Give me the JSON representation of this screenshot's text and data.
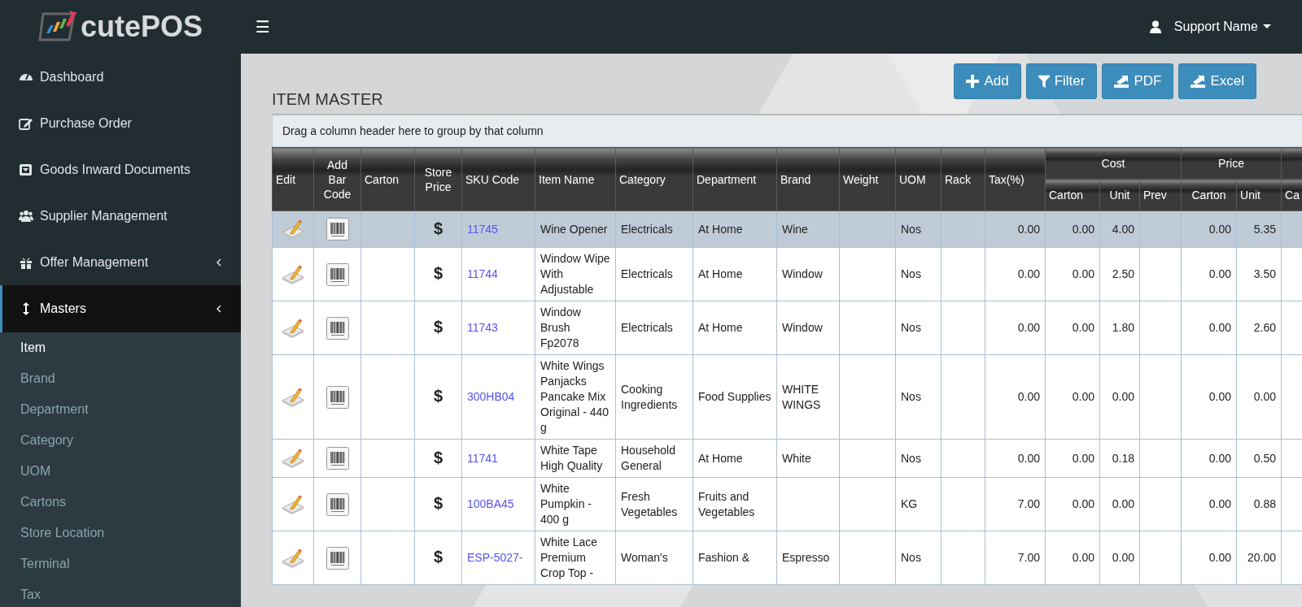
{
  "brand": {
    "name": "cutePOS"
  },
  "topbar": {
    "menu_glyph": "☰",
    "user": "Support Name"
  },
  "sidebar": {
    "items": [
      {
        "label": "Dashboard",
        "has_submenu": false,
        "selected": false
      },
      {
        "label": "Purchase Order",
        "has_submenu": false,
        "selected": false
      },
      {
        "label": "Goods Inward Documents",
        "has_submenu": false,
        "selected": false
      },
      {
        "label": "Supplier Management",
        "has_submenu": false,
        "selected": false
      },
      {
        "label": "Offer Management",
        "has_submenu": true,
        "selected": false
      },
      {
        "label": "Masters",
        "has_submenu": true,
        "selected": true,
        "children": [
          {
            "label": "Item",
            "selected": true
          },
          {
            "label": "Brand",
            "selected": false
          },
          {
            "label": "Department",
            "selected": false
          },
          {
            "label": "Category",
            "selected": false
          },
          {
            "label": "UOM",
            "selected": false
          },
          {
            "label": "Cartons",
            "selected": false
          },
          {
            "label": "Store Location",
            "selected": false
          },
          {
            "label": "Terminal",
            "selected": false
          },
          {
            "label": "Tax",
            "selected": false
          }
        ]
      }
    ]
  },
  "page": {
    "title": "ITEM MASTER",
    "buttons": [
      "Add",
      "Filter",
      "PDF",
      "Excel"
    ]
  },
  "table": {
    "group_hint": "Drag a column header here to group by that column",
    "columns": [
      {
        "label": "Edit"
      },
      {
        "label": "Add Bar Code"
      },
      {
        "label": "Carton"
      },
      {
        "label": "Store Price"
      },
      {
        "label": "SKU Code"
      },
      {
        "label": "Item Name"
      },
      {
        "label": "Category"
      },
      {
        "label": "Department"
      },
      {
        "label": "Brand"
      },
      {
        "label": "Weight"
      },
      {
        "label": "UOM"
      },
      {
        "label": "Rack"
      },
      {
        "label": "Tax(%)"
      },
      {
        "label": "Cost",
        "children": [
          {
            "label": "Carton"
          },
          {
            "label": "Unit"
          },
          {
            "label": "Prev"
          }
        ]
      },
      {
        "label": "Price",
        "children": [
          {
            "label": "Carton"
          },
          {
            "label": "Unit"
          }
        ]
      },
      {
        "children": [
          {
            "label": "Ca"
          }
        ]
      }
    ],
    "rows": [
      {
        "selected": true,
        "store_price": "$",
        "sku": "11745",
        "item_name": "Wine Opener",
        "category": "Electricals",
        "department": "At Home",
        "brand": "Wine",
        "uom": "Nos",
        "tax": "0.00",
        "cost_carton": "0.00",
        "cost_unit": "4.00",
        "price_carton": "0.00",
        "price_unit": "5.35"
      },
      {
        "selected": false,
        "store_price": "$",
        "sku": "11744",
        "item_name": "Window Wipe With Adjustable",
        "category": "Electricals",
        "department": "At Home",
        "brand": "Window",
        "uom": "Nos",
        "tax": "0.00",
        "cost_carton": "0.00",
        "cost_unit": "2.50",
        "price_carton": "0.00",
        "price_unit": "3.50"
      },
      {
        "selected": false,
        "store_price": "$",
        "sku": "11743",
        "item_name": "Window Brush Fp2078",
        "category": "Electricals",
        "department": "At Home",
        "brand": "Window",
        "uom": "Nos",
        "tax": "0.00",
        "cost_carton": "0.00",
        "cost_unit": "1.80",
        "price_carton": "0.00",
        "price_unit": "2.60"
      },
      {
        "selected": false,
        "store_price": "$",
        "sku": "300HB04",
        "item_name": "White Wings Panjacks Pancake Mix Original - 440 g",
        "category": "Cooking Ingredients",
        "department": "Food Supplies",
        "brand": "WHITE WINGS",
        "uom": "Nos",
        "tax": "0.00",
        "cost_carton": "0.00",
        "cost_unit": "0.00",
        "price_carton": "0.00",
        "price_unit": "0.00"
      },
      {
        "selected": false,
        "store_price": "$",
        "sku": "11741",
        "item_name": "White Tape High Quality",
        "category": "Household General",
        "department": "At Home",
        "brand": "White",
        "uom": "Nos",
        "tax": "0.00",
        "cost_carton": "0.00",
        "cost_unit": "0.18",
        "price_carton": "0.00",
        "price_unit": "0.50"
      },
      {
        "selected": false,
        "store_price": "$",
        "sku": "100BA45",
        "item_name": "White Pumpkin - 400 g",
        "category": "Fresh Vegetables",
        "department": "Fruits and Vegetables",
        "uom": "KG",
        "tax": "7.00",
        "cost_carton": "0.00",
        "cost_unit": "0.00",
        "price_carton": "0.00",
        "price_unit": "0.88"
      },
      {
        "selected": false,
        "store_price": "$",
        "sku": "ESP-5027-",
        "item_name": "White Lace Premium Crop Top -",
        "category": "Woman's",
        "department": "Fashion &",
        "brand": "Espresso",
        "uom": "Nos",
        "tax": "7.00",
        "cost_carton": "0.00",
        "cost_unit": "0.00",
        "price_carton": "0.00",
        "price_unit": "20.00"
      }
    ]
  }
}
